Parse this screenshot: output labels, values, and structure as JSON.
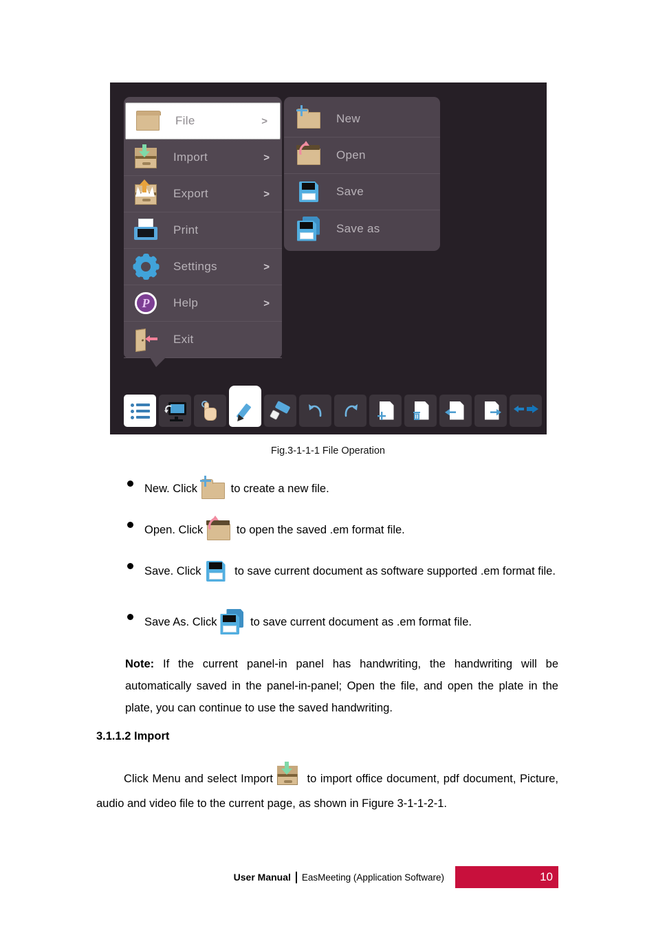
{
  "figure": {
    "caption": "Fig.3-1-1-1 File Operation",
    "menu": {
      "items": [
        {
          "label": "File",
          "icon": "folder-icon",
          "arrow": ">",
          "selected": true
        },
        {
          "label": "Import",
          "icon": "import-box-icon",
          "arrow": ">",
          "selected": false
        },
        {
          "label": "Export",
          "icon": "export-box-icon",
          "arrow": ">",
          "selected": false
        },
        {
          "label": "Print",
          "icon": "printer-icon",
          "arrow": "",
          "selected": false
        },
        {
          "label": "Settings",
          "icon": "gear-icon",
          "arrow": ">",
          "selected": false
        },
        {
          "label": "Help",
          "icon": "help-circle-icon",
          "arrow": ">",
          "selected": false
        },
        {
          "label": "Exit",
          "icon": "exit-door-icon",
          "arrow": "",
          "selected": false
        }
      ]
    },
    "submenu": {
      "items": [
        {
          "label": "New",
          "icon": "folder-new-icon"
        },
        {
          "label": "Open",
          "icon": "folder-open-icon"
        },
        {
          "label": "Save",
          "icon": "floppy-save-icon"
        },
        {
          "label": "Save as",
          "icon": "floppy-save-as-icon"
        }
      ]
    },
    "toolbar": {
      "buttons": [
        {
          "name": "menu-list-button",
          "icon": "list-icon",
          "state": "active"
        },
        {
          "name": "screen-share-button",
          "icon": "monitor-swap-icon",
          "state": "normal"
        },
        {
          "name": "touch-select-button",
          "icon": "hand-tap-icon",
          "state": "normal"
        },
        {
          "name": "pen-button",
          "icon": "pencil-icon",
          "state": "active-tall"
        },
        {
          "name": "eraser-button",
          "icon": "eraser-icon",
          "state": "normal"
        },
        {
          "name": "undo-button",
          "icon": "undo-arrow-icon",
          "state": "normal"
        },
        {
          "name": "redo-button",
          "icon": "redo-arrow-icon",
          "state": "normal"
        },
        {
          "name": "add-page-button",
          "icon": "page-plus-icon",
          "state": "normal"
        },
        {
          "name": "delete-page-button",
          "icon": "page-trash-icon",
          "state": "normal"
        },
        {
          "name": "prev-page-button",
          "icon": "page-left-icon",
          "state": "normal"
        },
        {
          "name": "next-page-button",
          "icon": "page-right-icon",
          "state": "normal"
        },
        {
          "name": "exit-nav-button",
          "icon": "back-forward-icon",
          "state": "normal"
        }
      ]
    },
    "colors": {
      "background": "#261f26",
      "menu_panel": "#514751",
      "submenu_panel": "#4d434d",
      "menu_text": "#b8b2b8",
      "selected_row": "#ffffff"
    }
  },
  "body": {
    "bullets": [
      {
        "icon": "folder-new-icon",
        "before": "New. Click",
        "after": "to create a new file."
      },
      {
        "icon": "folder-open-icon",
        "before": "Open. Click",
        "after": "to open the saved .em format file."
      },
      {
        "icon": "floppy-save-icon",
        "before": "Save.  Click",
        "after": "to  save  current  document  as  software  supported  .em format file."
      },
      {
        "icon": "floppy-save-as-icon",
        "before": "Save As. Click",
        "after": "to save current document as .em format file."
      }
    ],
    "note": {
      "label": "Note:",
      "text": "If  the  current  panel-in  panel  has  handwriting,  the  handwriting  will  be automatically  saved  in  the  panel-in-panel;  Open  the  file,  and  open  the plate in the plate, you can continue to use the saved handwriting."
    },
    "section_heading": "3.1.1.2 Import",
    "paragraph": {
      "before": "Click Menu and select Import",
      "icon": "import-box-icon",
      "after": "to import office document, pdf document, Picture, audio and video file to the current page, as shown in Figure 3-1-1-2-1."
    }
  },
  "footer": {
    "manual_label": "User Manual",
    "product_label": "EasMeeting (Application Software)",
    "page_number": "10",
    "accent_color": "#C8103C"
  }
}
